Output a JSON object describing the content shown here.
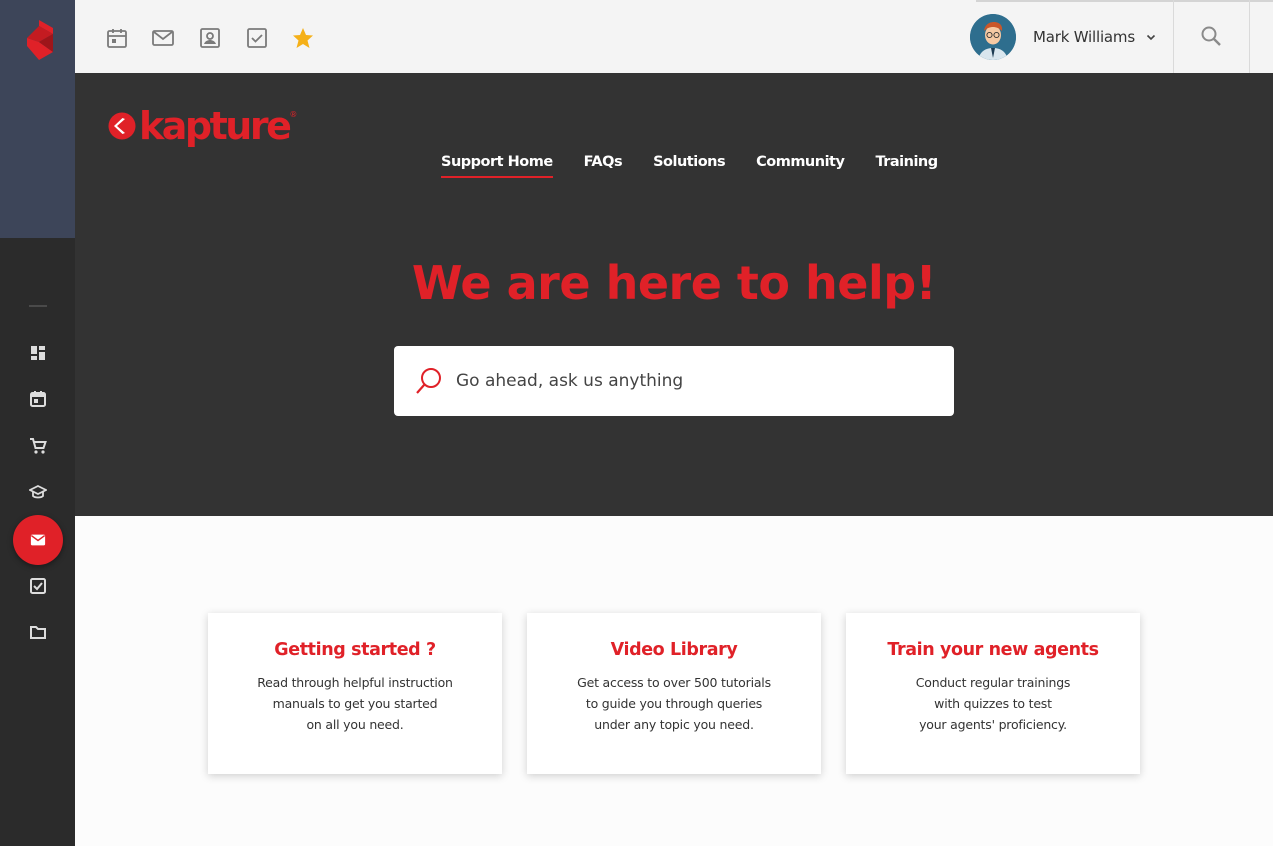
{
  "brand": {
    "name": "kapture",
    "registered": "®",
    "accent": "#e02128"
  },
  "sidebar": {
    "items": [
      {
        "icon": "dashboard-icon"
      },
      {
        "icon": "calendar-icon"
      },
      {
        "icon": "cart-icon"
      },
      {
        "icon": "graduation-cap-icon"
      },
      {
        "icon": "mail-icon",
        "active": true
      },
      {
        "icon": "checkbox-icon"
      },
      {
        "icon": "folder-icon"
      }
    ]
  },
  "topbar": {
    "icons": [
      "calendar-icon",
      "mail-icon",
      "contact-icon",
      "checkbox-icon",
      "star-icon"
    ],
    "user": {
      "name": "Mark Williams"
    }
  },
  "nav": {
    "items": [
      {
        "label": "Support Home",
        "active": true
      },
      {
        "label": "FAQs"
      },
      {
        "label": "Solutions"
      },
      {
        "label": "Community"
      },
      {
        "label": "Training"
      }
    ]
  },
  "hero": {
    "title": "We are here to help!",
    "search_placeholder": "Go ahead, ask us anything"
  },
  "cards": [
    {
      "title": "Getting started ?",
      "lines": [
        "Read through helpful instruction",
        "manuals to get you started",
        "on all you need."
      ]
    },
    {
      "title": "Video Library",
      "lines": [
        "Get access to over 500 tutorials",
        "to guide you through queries",
        "under any topic you need."
      ]
    },
    {
      "title": "Train your new agents",
      "lines": [
        "Conduct regular trainings",
        "with quizzes to test",
        "your agents' proficiency."
      ]
    }
  ]
}
